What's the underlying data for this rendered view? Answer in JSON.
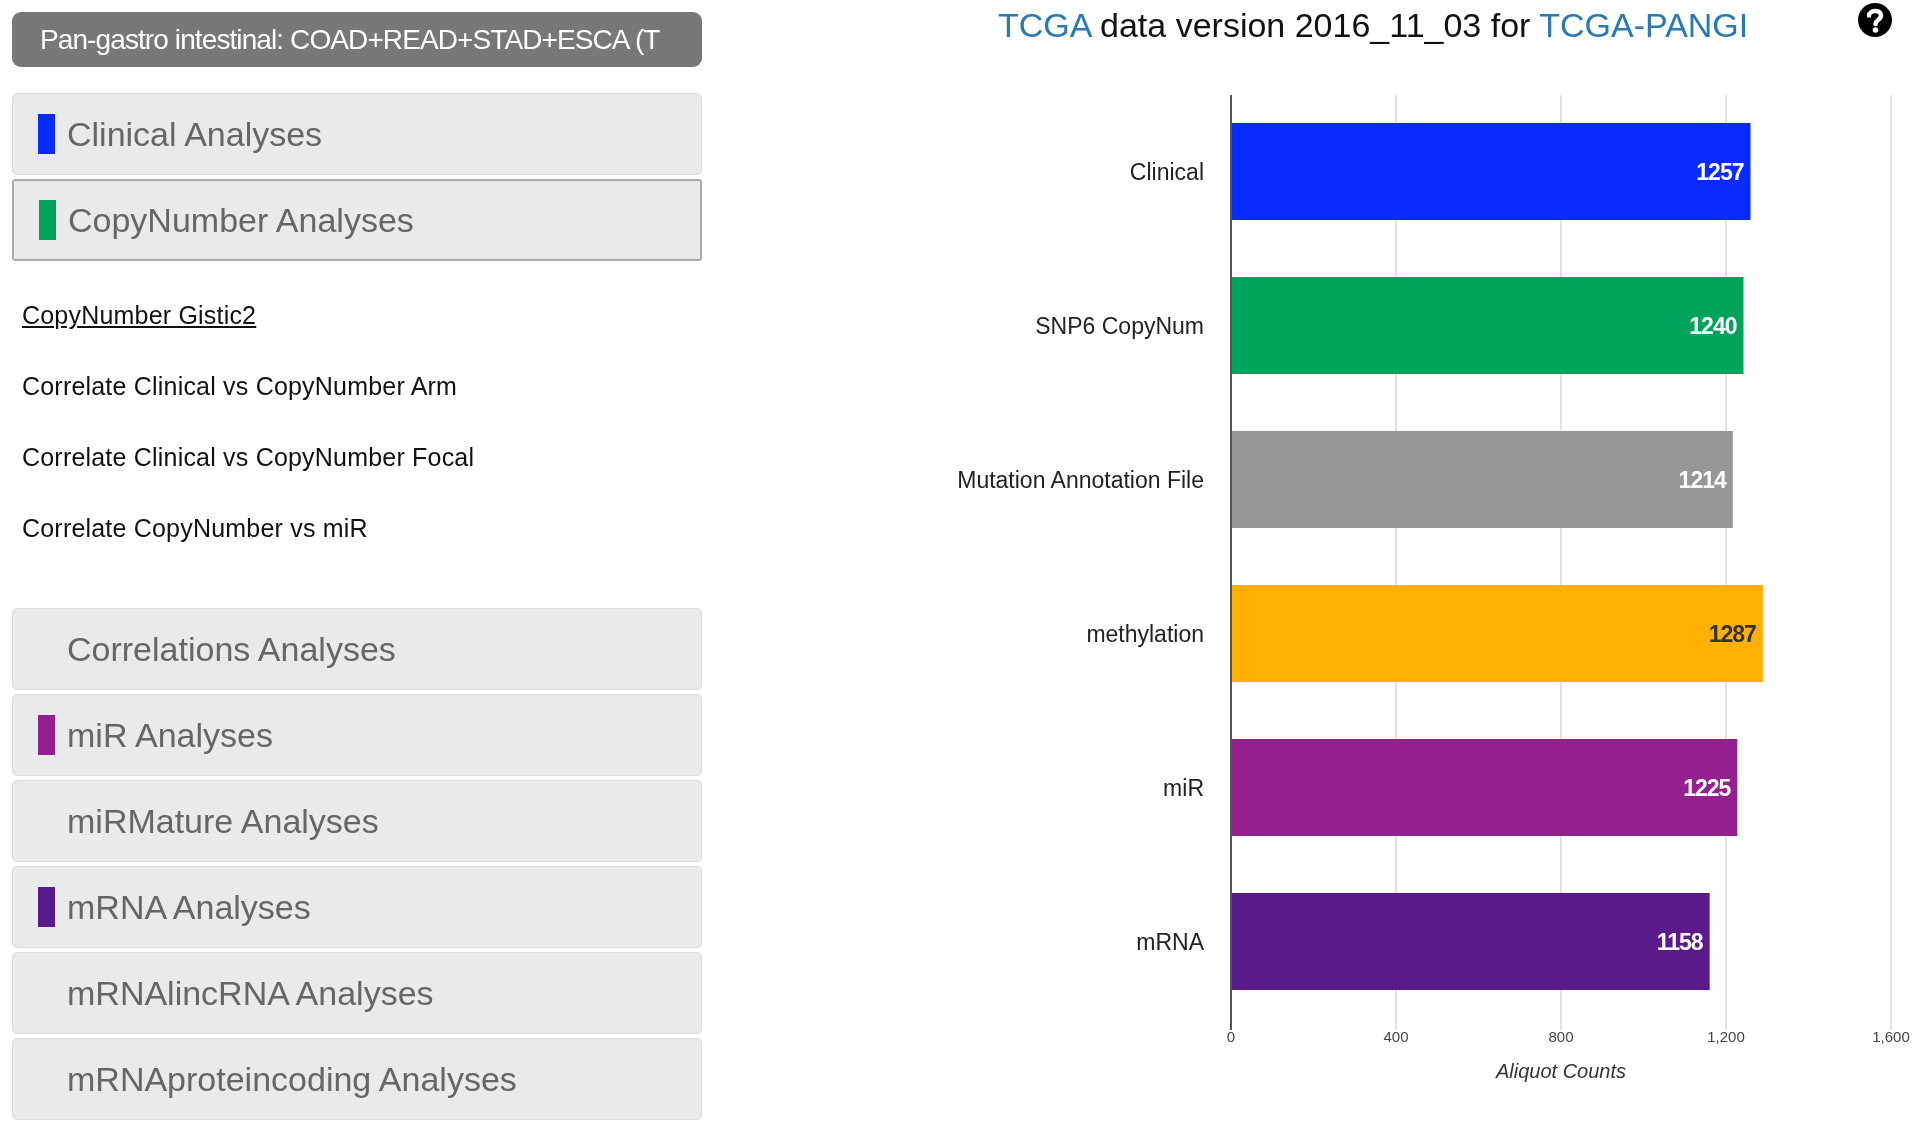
{
  "header": {
    "title": "Pan-gastro intestinal: COAD+READ+STAD+ESCA (T"
  },
  "panels": [
    {
      "label": "Clinical Analyses",
      "color": "#0a2bff",
      "expanded": false
    },
    {
      "label": "CopyNumber Analyses",
      "color": "#00a35a",
      "expanded": true,
      "children": [
        {
          "label": "CopyNumber Gistic2",
          "selected": true
        },
        {
          "label": "Correlate Clinical vs CopyNumber Arm",
          "selected": false
        },
        {
          "label": "Correlate Clinical vs CopyNumber Focal",
          "selected": false
        },
        {
          "label": "Correlate CopyNumber vs miR",
          "selected": false
        }
      ]
    },
    {
      "label": "Correlations Analyses",
      "expanded": false
    },
    {
      "label": "miR Analyses",
      "color": "#941f8f",
      "expanded": false
    },
    {
      "label": "miRMature Analyses",
      "expanded": false
    },
    {
      "label": "mRNA Analyses",
      "color": "#5a1a8c",
      "expanded": false
    },
    {
      "label": "mRNAlincRNA Analyses",
      "expanded": false
    },
    {
      "label": "mRNAproteincoding Analyses",
      "expanded": false
    }
  ],
  "title": [
    {
      "kind": "link",
      "text": "TCGA"
    },
    {
      "kind": "text",
      "text": " data version 2016_11_03 for "
    },
    {
      "kind": "link",
      "text": "TCGA-PANGI"
    }
  ],
  "chart_data": {
    "type": "bar",
    "orientation": "horizontal",
    "xlabel": "Aliquot Counts",
    "categories": [
      "Clinical",
      "SNP6 CopyNum",
      "Mutation Annotation File",
      "methylation",
      "miR",
      "mRNA"
    ],
    "series": [
      {
        "values": [
          1257,
          1240,
          1214,
          1287,
          1225,
          1158
        ]
      }
    ],
    "colors": [
      "#0a2bff",
      "#00a35a",
      "#969696",
      "#ffb000",
      "#941f8f",
      "#5a1a8c"
    ],
    "xlim": [
      0,
      1600
    ],
    "xticks": [
      {
        "value": 0,
        "label": "0"
      },
      {
        "value": 400,
        "label": "400"
      },
      {
        "value": 800,
        "label": "800"
      },
      {
        "value": 1200,
        "label": "1,200"
      },
      {
        "value": 1600,
        "label": "1,600"
      }
    ],
    "data_labels": true,
    "grid": true
  }
}
